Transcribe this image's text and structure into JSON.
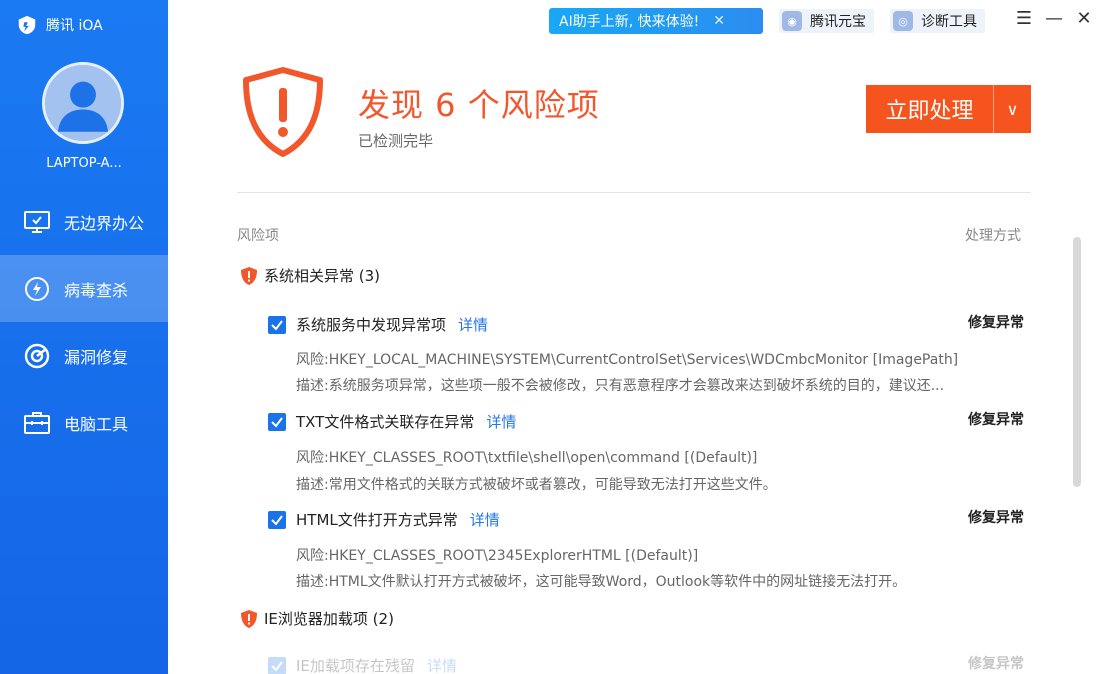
{
  "app": {
    "brand": "腾讯 iOA",
    "host": "LAPTOP-A..."
  },
  "sidebar": {
    "items": [
      {
        "label": "无边界办公",
        "icon": "monitor-check-icon",
        "active": false
      },
      {
        "label": "病毒查杀",
        "icon": "lightning-circle-icon",
        "active": true
      },
      {
        "label": "漏洞修复",
        "icon": "target-icon",
        "active": false
      },
      {
        "label": "电脑工具",
        "icon": "toolbox-icon",
        "active": false
      }
    ]
  },
  "topbar": {
    "ai_banner": "AI助手上新, 快来体验!",
    "yuanbao": "腾讯元宝",
    "diagnose": "诊断工具"
  },
  "header": {
    "title": "发现 6 个风险项",
    "subtitle": "已检测完毕",
    "action": "立即处理"
  },
  "list": {
    "col_left": "风险项",
    "col_right": "处理方式",
    "groups": [
      {
        "title": "系统相关异常 (3)",
        "items": [
          {
            "name": "系统服务中发现异常项",
            "detail": "详情",
            "fix": "修复异常",
            "risk": "风险:HKEY_LOCAL_MACHINE\\SYSTEM\\CurrentControlSet\\Services\\WDCmbcMonitor [ImagePath]",
            "desc": "描述:系统服务项异常，这些项一般不会被修改，只有恶意程序才会篡改来达到破坏系统的目的，建议还..."
          },
          {
            "name": "TXT文件格式关联存在异常",
            "detail": "详情",
            "fix": "修复异常",
            "risk": "风险:HKEY_CLASSES_ROOT\\txtfile\\shell\\open\\command [(Default)]",
            "desc": "描述:常用文件格式的关联方式被破坏或者篡改，可能导致无法打开这些文件。"
          },
          {
            "name": "HTML文件打开方式异常",
            "detail": "详情",
            "fix": "修复异常",
            "risk": "风险:HKEY_CLASSES_ROOT\\2345ExplorerHTML [(Default)]",
            "desc": "描述:HTML文件默认打开方式被破坏，这可能导致Word，Outlook等软件中的网址链接无法打开。"
          }
        ]
      },
      {
        "title": "IE浏览器加载项 (2)",
        "items": [
          {
            "name": "IE加载项存在残留",
            "detail": "详情",
            "fix": "修复异常"
          }
        ]
      }
    ]
  },
  "colors": {
    "sidebar": "#1677f0",
    "accent": "#f5541f",
    "link": "#2377e6"
  }
}
